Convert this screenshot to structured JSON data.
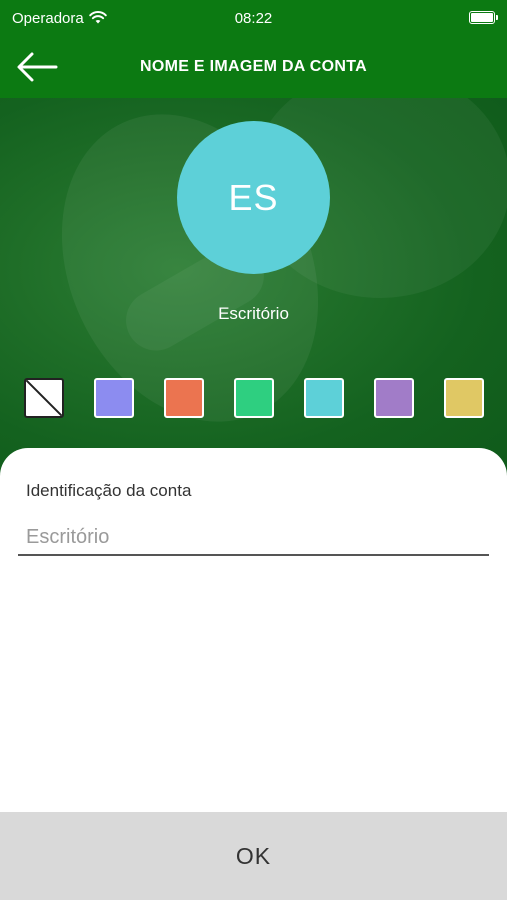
{
  "status_bar": {
    "carrier": "Operadora",
    "time": "08:22",
    "wifi_icon": "wifi-icon",
    "battery_icon": "battery-icon"
  },
  "nav": {
    "title": "NOME E IMAGEM DA CONTA",
    "back_icon": "arrow-left-icon"
  },
  "avatar": {
    "initials": "ES",
    "color": "#5dd0d8"
  },
  "account_name": "Escritório",
  "color_options": [
    {
      "name": "none",
      "color": "#ffffff"
    },
    {
      "name": "lavender",
      "color": "#8c8cf0"
    },
    {
      "name": "orange",
      "color": "#eb7450"
    },
    {
      "name": "green",
      "color": "#2ecf80"
    },
    {
      "name": "cyan",
      "color": "#5dd0d8"
    },
    {
      "name": "purple",
      "color": "#a17cc8"
    },
    {
      "name": "yellow",
      "color": "#e0c864"
    }
  ],
  "form": {
    "label": "Identificação da conta",
    "placeholder": "Escritório",
    "value": ""
  },
  "ok_button": "OK",
  "colors": {
    "primary_green": "#0c7a12",
    "bottom_bar": "#d9d9d9"
  }
}
